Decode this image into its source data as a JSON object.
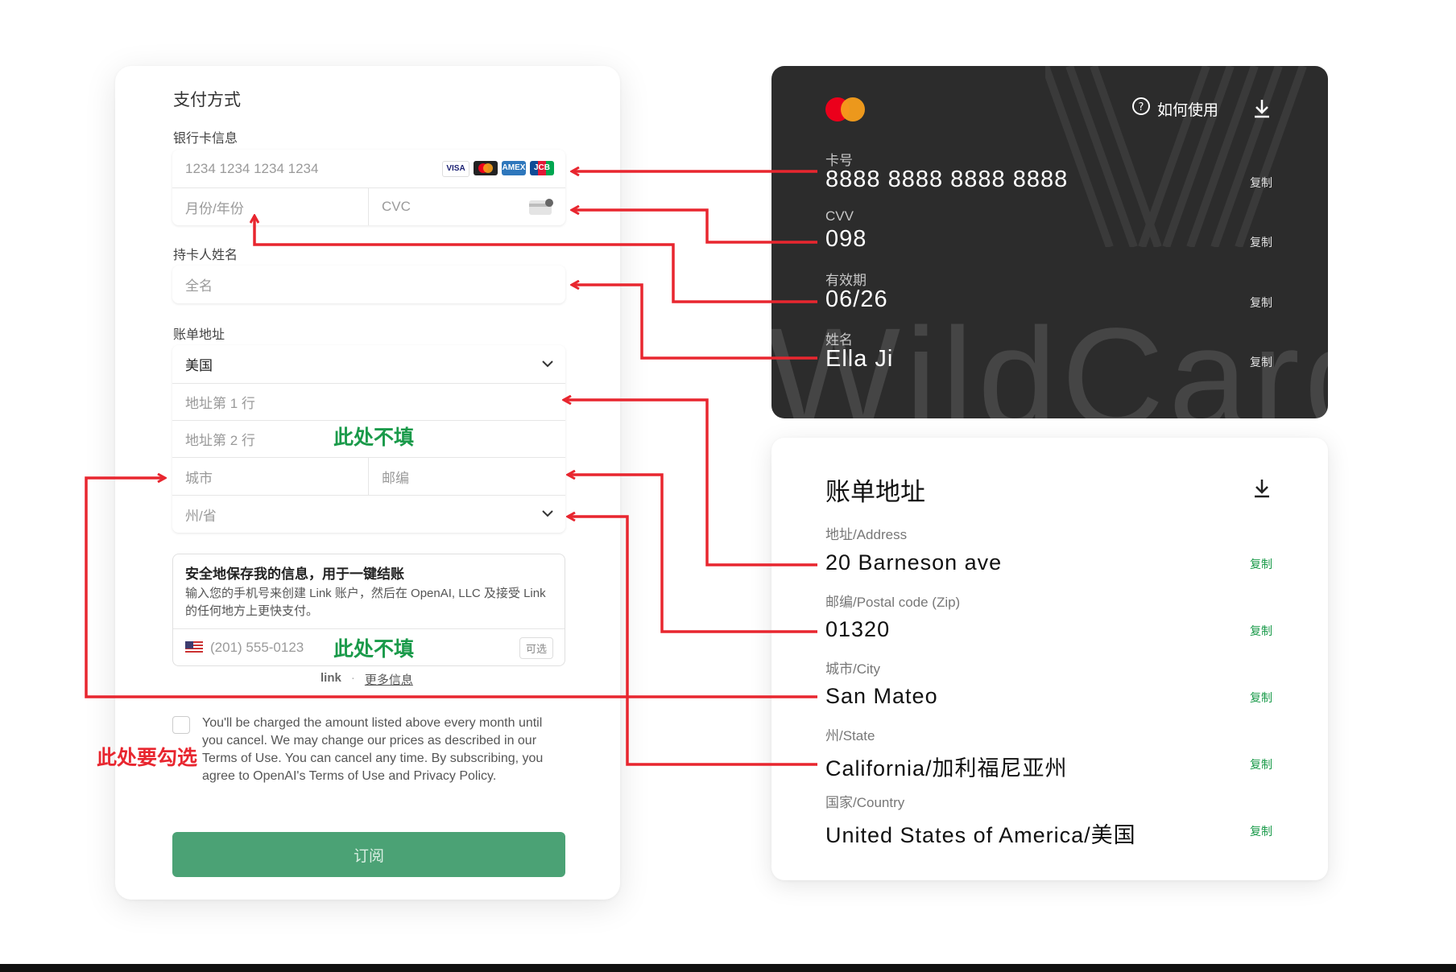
{
  "payment_form": {
    "title": "支付方式",
    "card_info_label": "银行卡信息",
    "card_number_placeholder": "1234 1234 1234 1234",
    "card_brands": [
      "VISA",
      "MC",
      "AMEX",
      "JCB"
    ],
    "expiry_placeholder": "月份/年份",
    "cvc_placeholder": "CVC",
    "cardholder_label": "持卡人姓名",
    "fullname_placeholder": "全名",
    "billing_label": "账单地址",
    "country_value": "美国",
    "address1_placeholder": "地址第 1 行",
    "address2_placeholder": "地址第 2 行",
    "city_placeholder": "城市",
    "zip_placeholder": "邮编",
    "state_placeholder": "州/省",
    "save_info_title": "安全地保存我的信息，用于一键结账",
    "save_info_desc": "输入您的手机号来创建 Link 账户，然后在 OpenAI, LLC 及接受 Link 的任何地方上更快支付。",
    "phone_placeholder": "(201) 555-0123",
    "optional_badge": "可选",
    "link_logo": "link",
    "link_sep": "·",
    "more_info": "更多信息",
    "terms_text": "You'll be charged the amount listed above every month until you cancel. We may change our prices as described in our Terms of Use. You can cancel any time. By subscribing, you agree to OpenAI's Terms of Use and Privacy Policy.",
    "subscribe_button": "订阅"
  },
  "annotations": {
    "skip_address2": "此处不填",
    "skip_phone": "此处不填",
    "must_check": "此处要勾选"
  },
  "card": {
    "how_to_use": "如何使用",
    "number_label": "卡号",
    "number_value": "8888 8888 8888 8888",
    "cvv_label": "CVV",
    "cvv_value": "098",
    "expiry_label": "有效期",
    "expiry_value": "06/26",
    "name_label": "姓名",
    "name_value": "Ella Ji",
    "copy_label": "复制",
    "watermark": "WildCard"
  },
  "address": {
    "title": "账单地址",
    "copy_label": "复制",
    "fields": [
      {
        "label": "地址/Address",
        "value": "20 Barneson ave"
      },
      {
        "label": "邮编/Postal code (Zip)",
        "value": "01320"
      },
      {
        "label": "城市/City",
        "value": "San Mateo"
      },
      {
        "label": "州/State",
        "value": "California/加利福尼亚州"
      },
      {
        "label": "国家/Country",
        "value": "United States of America/美国"
      }
    ]
  },
  "colors": {
    "accent_green": "#1a9a4a",
    "button_green": "#4ba275",
    "arrow_red": "#e8262f",
    "card_dark": "#2c2c2c"
  }
}
